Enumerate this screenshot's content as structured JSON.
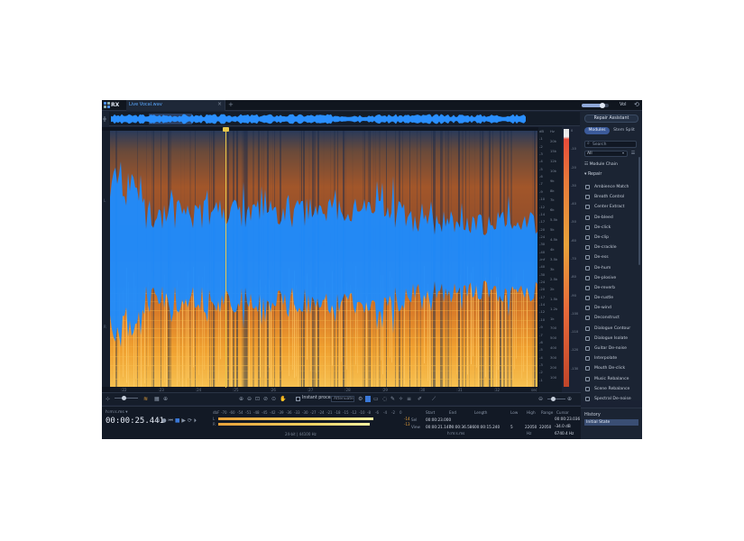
{
  "app": {
    "logo": "RX",
    "file_tab": "Live Vocal.wav",
    "add_tab": "+",
    "volume_label": "Vol",
    "volume_level": 0.75
  },
  "colors": {
    "accent": "#3a78d8",
    "waveform": "#2a8fff",
    "playhead": "#e6c64a",
    "bg": "#1a2233"
  },
  "spectrogram": {
    "db_scale": [
      "dB",
      "-1",
      "-2",
      "-3",
      "-4",
      "-5",
      "-6",
      "-7",
      "-9",
      "-10",
      "-12",
      "-14",
      "-17",
      "-20",
      "-24",
      "-30",
      "-40",
      "-inf",
      "-40",
      "-30",
      "-24",
      "-20",
      "-17",
      "-14",
      "-12",
      "-10",
      "-9",
      "-7",
      "-6",
      "-5",
      "-4",
      "-3",
      "-2",
      "-1"
    ],
    "hz_scale": [
      "Hz",
      "20k",
      "15k",
      "12k",
      "10k",
      "9k",
      "8k",
      "7k",
      "6k",
      "5.5k",
      "5k",
      "4.5k",
      "4k",
      "3.5k",
      "3k",
      "2.5k",
      "2k",
      "1.5k",
      "1.2k",
      "1k",
      "700",
      "500",
      "400",
      "300",
      "200",
      "100"
    ],
    "meter_scale": [
      "0",
      "-10",
      "-20",
      "-30",
      "-40",
      "-50",
      "-60",
      "-70",
      "-80",
      "-90",
      "-100",
      "-110",
      "-120",
      "-130"
    ],
    "time_ticks": [
      ":22",
      ":23",
      ":24",
      ":25",
      ":26",
      ":27",
      ":28",
      ":29",
      ":30",
      ":31",
      ":32",
      "sec"
    ],
    "left_ruler": [
      "L",
      "R"
    ],
    "playhead_time": 0.27
  },
  "right_panel": {
    "repair_assistant": "Repair Assistant",
    "tabs": [
      "Modules",
      "Stem Split"
    ],
    "search_placeholder": "Search",
    "filter": "All",
    "module_chain": "Module Chain",
    "section": "Repair",
    "modules": [
      "Ambience Match",
      "Breath Control",
      "Center Extract",
      "De-bleed",
      "De-click",
      "De-clip",
      "De-crackle",
      "De-ess",
      "De-hum",
      "De-plosive",
      "De-reverb",
      "De-rustle",
      "De-wind",
      "Deconstruct",
      "Dialogue Contour",
      "Dialogue Isolate",
      "Guitar De-noise",
      "Interpolate",
      "Mouth De-click",
      "Music Rebalance",
      "Scene Rebalance",
      "Spectral De-noise"
    ]
  },
  "history": {
    "title": "History",
    "item": "Initial State"
  },
  "toolbar": {
    "instant_process": "Instant process",
    "attenuate": "Attenuate"
  },
  "status": {
    "format": "h:m:s.ms ▾",
    "time": "00:00:25.441",
    "level_ticks": [
      "dbF",
      "-70",
      "-60",
      "-54",
      "-51",
      "-48",
      "-45",
      "-42",
      "-39",
      "-36",
      "-33",
      "-30",
      "-27",
      "-24",
      "-21",
      "-18",
      "-15",
      "-12",
      "-10",
      "-8",
      "-6",
      "-4",
      "-2",
      "0"
    ],
    "channel_l": "L",
    "channel_r": "R",
    "peak_l": "-14",
    "peak_r": "-13",
    "format_caption": "24-bit | 44100 Hz",
    "sel_headers": [
      "Start",
      "End",
      "Length"
    ],
    "sel_row_label": "Sel",
    "sel_row": [
      "00:00:23.000",
      "",
      ""
    ],
    "view_row_label": "View",
    "view_row": [
      "00:00:21.147",
      "00:00:36.586",
      "00:00:15.240"
    ],
    "sel_units": "h:m:s.ms",
    "freq_headers": [
      "Low",
      "High",
      "Range"
    ],
    "freq_row": [
      "5",
      "22050",
      "22050"
    ],
    "freq_units": "Hz",
    "cursor_header": "Cursor",
    "cursor_time": "00:00:23.036",
    "cursor_db": "-34.0 dB",
    "cursor_hz": "6740.4 Hz"
  }
}
